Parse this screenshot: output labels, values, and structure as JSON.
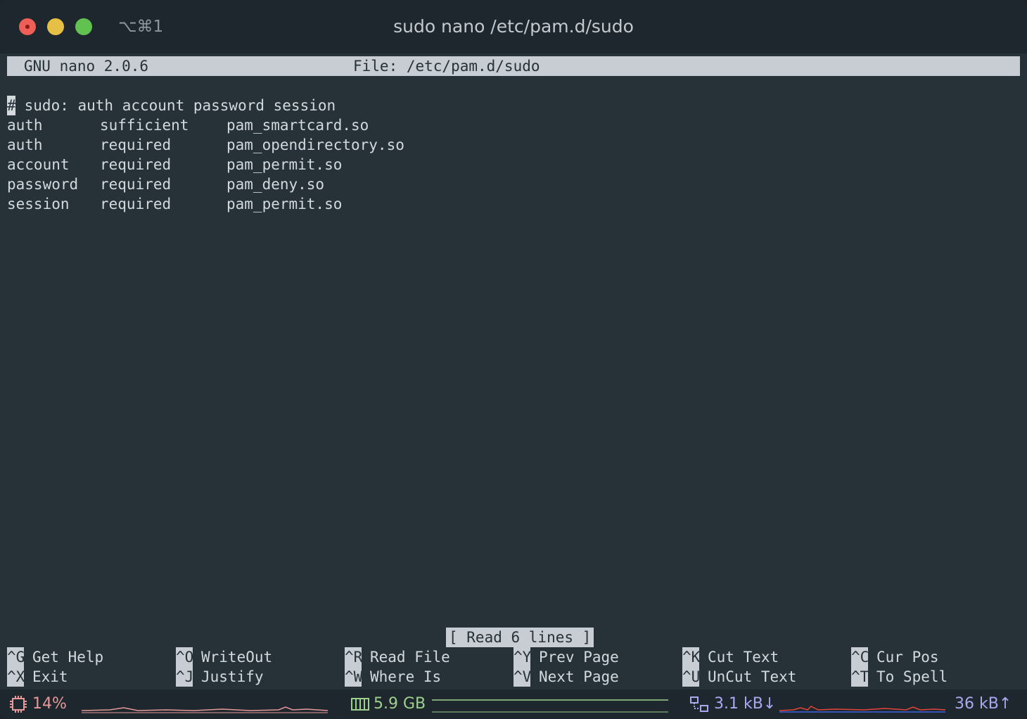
{
  "titlebar": {
    "shortcut": "⌥⌘1",
    "title": "sudo nano /etc/pam.d/sudo"
  },
  "nano": {
    "version": "GNU nano 2.0.6",
    "file": "File: /etc/pam.d/sudo",
    "comment_cursor": "#",
    "comment_rest": " sudo: auth account password session",
    "rows": [
      [
        "auth",
        "sufficient",
        "pam_smartcard.so"
      ],
      [
        "auth",
        "required",
        "pam_opendirectory.so"
      ],
      [
        "account",
        "required",
        "pam_permit.so"
      ],
      [
        "password",
        "required",
        "pam_deny.so"
      ],
      [
        "session",
        "required",
        "pam_permit.so"
      ]
    ],
    "status": "[ Read 6 lines ]",
    "shortcuts": [
      {
        "key": "^G",
        "label": "Get Help"
      },
      {
        "key": "^O",
        "label": "WriteOut"
      },
      {
        "key": "^R",
        "label": "Read File"
      },
      {
        "key": "^Y",
        "label": "Prev Page"
      },
      {
        "key": "^K",
        "label": "Cut Text"
      },
      {
        "key": "^C",
        "label": "Cur Pos"
      },
      {
        "key": "^X",
        "label": "Exit"
      },
      {
        "key": "^J",
        "label": "Justify"
      },
      {
        "key": "^W",
        "label": "Where Is"
      },
      {
        "key": "^V",
        "label": "Next Page"
      },
      {
        "key": "^U",
        "label": "UnCut Text"
      },
      {
        "key": "^T",
        "label": "To Spell"
      }
    ]
  },
  "statusbar": {
    "cpu": "14%",
    "memory": "5.9 GB",
    "net_down": "3.1 kB↓",
    "net_up": "36 kB↑",
    "colors": {
      "cpu": "#e59a99",
      "memory": "#9dd08c",
      "network": "#a9a9ef"
    }
  }
}
